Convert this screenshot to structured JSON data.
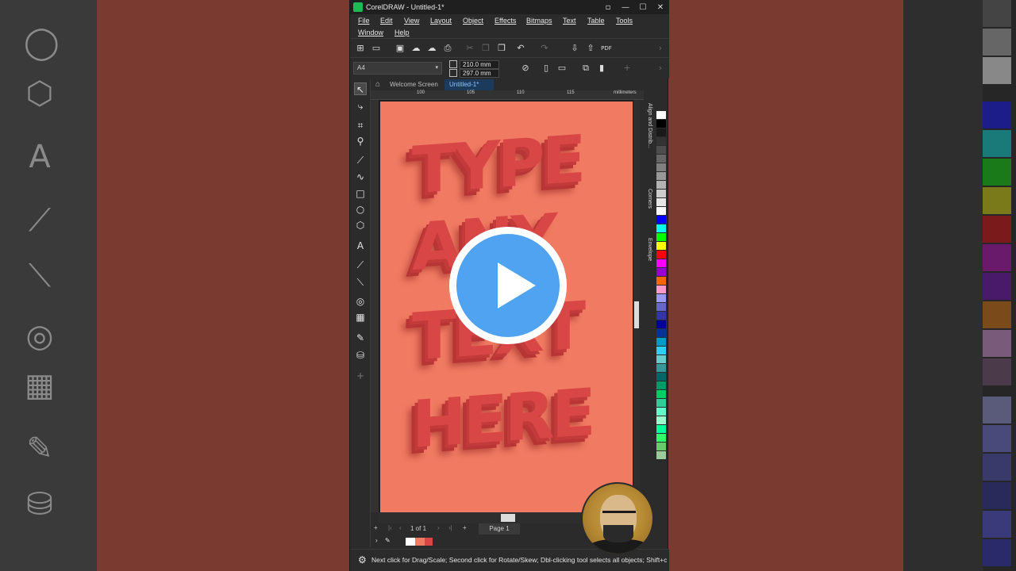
{
  "window": {
    "title": "CorelDRAW - Untitled-1*",
    "controls": [
      "▫",
      "—",
      "☐",
      "✕"
    ]
  },
  "menu": {
    "items": [
      "File",
      "Edit",
      "View",
      "Layout",
      "Object",
      "Effects",
      "Bitmaps",
      "Text",
      "Table",
      "Tools",
      "Window",
      "Help"
    ]
  },
  "propbar": {
    "page_size": "A4",
    "width": "210.0 mm",
    "height": "297.0 mm"
  },
  "tabs": {
    "welcome": "Welcome Screen",
    "document": "Untitled-1*"
  },
  "ruler": {
    "labels": [
      "100",
      "105",
      "110",
      "115"
    ],
    "unit": "millimeters"
  },
  "artwork": {
    "lines": [
      "TYPE",
      "ANY",
      "TEXT",
      "HERE"
    ],
    "page_color": "#f07a62",
    "text_color": "#d94646"
  },
  "pagenav": {
    "counter": "1 of 1",
    "page_tab": "Page 1"
  },
  "dockers": {
    "tabs": [
      "Align and Distrib...",
      "Corners",
      "Envelope"
    ]
  },
  "status": {
    "text": "Next click for Drag/Scale; Second click for Rotate/Skew; Dbl-clicking tool selects all objects; Shift+click"
  },
  "palette": {
    "colors": [
      "#ffffff",
      "#000000",
      "#1a1a1a",
      "#333333",
      "#4d4d4d",
      "#666666",
      "#808080",
      "#999999",
      "#b3b3b3",
      "#cccccc",
      "#e6e6e6",
      "#ffffff",
      "#0000ff",
      "#00ffff",
      "#00ff00",
      "#ffff00",
      "#ff0000",
      "#ff00ff",
      "#9900cc",
      "#ff6600",
      "#ff99cc",
      "#9999ff",
      "#6666cc",
      "#3333aa",
      "#000099",
      "#003399",
      "#0099cc",
      "#33ccff",
      "#66cccc",
      "#339999",
      "#006666",
      "#009966",
      "#00cc66",
      "#33cc99",
      "#66ffcc",
      "#99ffcc",
      "#00ff99",
      "#33ff66",
      "#66cc66",
      "#99cc99"
    ]
  },
  "overlay": {
    "play_button": "play-icon"
  }
}
